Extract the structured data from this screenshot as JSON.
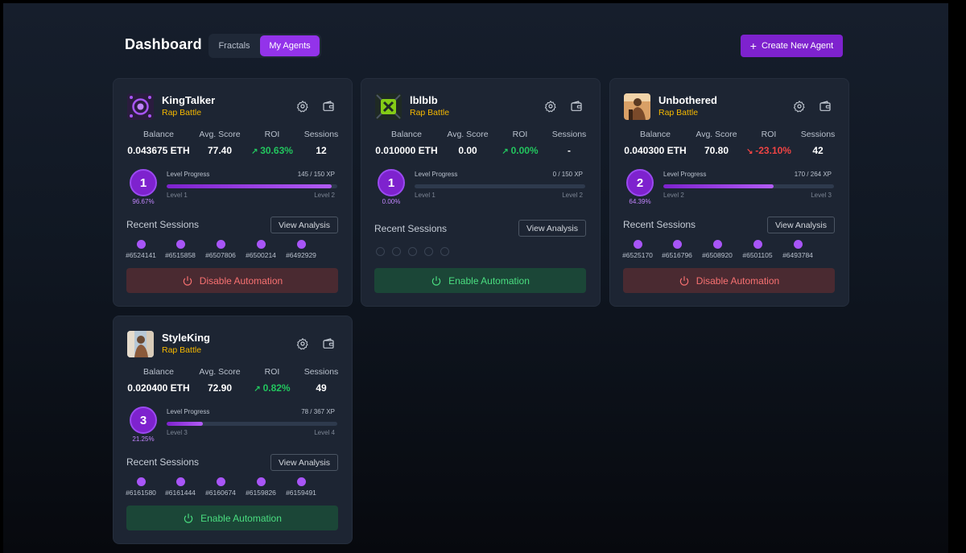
{
  "header": {
    "title": "Dashboard",
    "tabs": [
      {
        "label": "Fractals",
        "active": false
      },
      {
        "label": "My Agents",
        "active": true
      }
    ],
    "create_label": "Create New Agent"
  },
  "stat_labels": {
    "balance": "Balance",
    "avg_score": "Avg. Score",
    "roi": "ROI",
    "sessions": "Sessions"
  },
  "level_progress_label": "Level Progress",
  "recent_sessions_label": "Recent Sessions",
  "view_analysis_label": "View Analysis",
  "colors": {
    "accent": "#9333ea",
    "positive": "#22c55e",
    "negative": "#ef4444",
    "category": "#f5b800"
  },
  "agents": [
    {
      "name": "KingTalker",
      "category": "Rap Battle",
      "avatar_icon": "purple-orb-icon",
      "balance": "0.043675 ETH",
      "avg_score": "77.40",
      "roi": "30.63%",
      "roi_trend": "up",
      "sessions": "12",
      "level": "1",
      "level_pct": "96.67%",
      "xp": "145 / 150 XP",
      "progress": 0.9667,
      "level_from": "Level 1",
      "level_to": "Level 2",
      "recent_sessions": [
        "#6524141",
        "#6515858",
        "#6507806",
        "#6500214",
        "#6492929"
      ],
      "automation_label": "Disable Automation",
      "automation_state": "enabled"
    },
    {
      "name": "lblblb",
      "category": "Rap Battle",
      "avatar_icon": "green-x-icon",
      "balance": "0.010000 ETH",
      "avg_score": "0.00",
      "roi": "0.00%",
      "roi_trend": "up",
      "sessions": "-",
      "level": "1",
      "level_pct": "0.00%",
      "xp": "0 / 150 XP",
      "progress": 0,
      "level_from": "Level 1",
      "level_to": "Level 2",
      "recent_sessions": [],
      "automation_label": "Enable Automation",
      "automation_state": "disabled"
    },
    {
      "name": "Unbothered",
      "category": "Rap Battle",
      "avatar_icon": "portrait-icon",
      "balance": "0.040300 ETH",
      "avg_score": "70.80",
      "roi": "-23.10%",
      "roi_trend": "down",
      "sessions": "42",
      "level": "2",
      "level_pct": "64.39%",
      "xp": "170 / 264 XP",
      "progress": 0.6439,
      "level_from": "Level 2",
      "level_to": "Level 3",
      "recent_sessions": [
        "#6525170",
        "#6516796",
        "#6508920",
        "#6501105",
        "#6493784"
      ],
      "automation_label": "Disable Automation",
      "automation_state": "enabled"
    },
    {
      "name": "StyleKing",
      "category": "Rap Battle",
      "avatar_icon": "portrait-icon",
      "balance": "0.020400 ETH",
      "avg_score": "72.90",
      "roi": "0.82%",
      "roi_trend": "up",
      "sessions": "49",
      "level": "3",
      "level_pct": "21.25%",
      "xp": "78 / 367 XP",
      "progress": 0.2125,
      "level_from": "Level 3",
      "level_to": "Level 4",
      "recent_sessions": [
        "#6161580",
        "#6161444",
        "#6160674",
        "#6159826",
        "#6159491"
      ],
      "automation_label": "Enable Automation",
      "automation_state": "disabled"
    }
  ]
}
